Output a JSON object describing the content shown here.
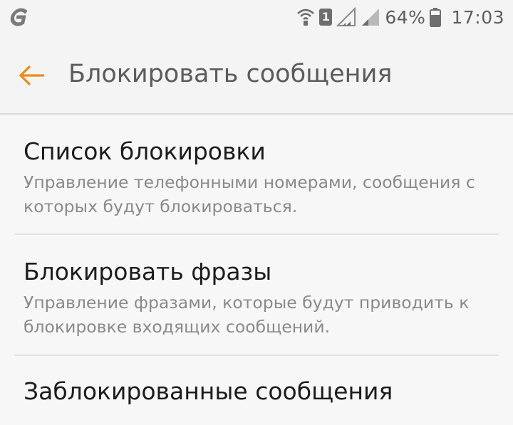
{
  "status_bar": {
    "battery_percent": "64%",
    "time": "17:03",
    "sim_label": "1",
    "icons": [
      "g-notification-icon",
      "wifi-calling-icon",
      "sim-1-icon",
      "signal-1-icon",
      "signal-2-icon",
      "battery-icon"
    ],
    "icon_color": "#6a6a6a"
  },
  "app_bar": {
    "title": "Блокировать сообщения",
    "back_icon": "back-arrow-icon",
    "accent_color": "#ef8a14"
  },
  "items": [
    {
      "title": "Список блокировки",
      "summary": "Управление телефонными номерами, сообщения с которых будут блокироваться."
    },
    {
      "title": "Блокировать фразы",
      "summary": "Управление фразами, которые будут приводить к блокировке входящих сообщений."
    },
    {
      "title": "Заблокированные сообщения"
    }
  ]
}
